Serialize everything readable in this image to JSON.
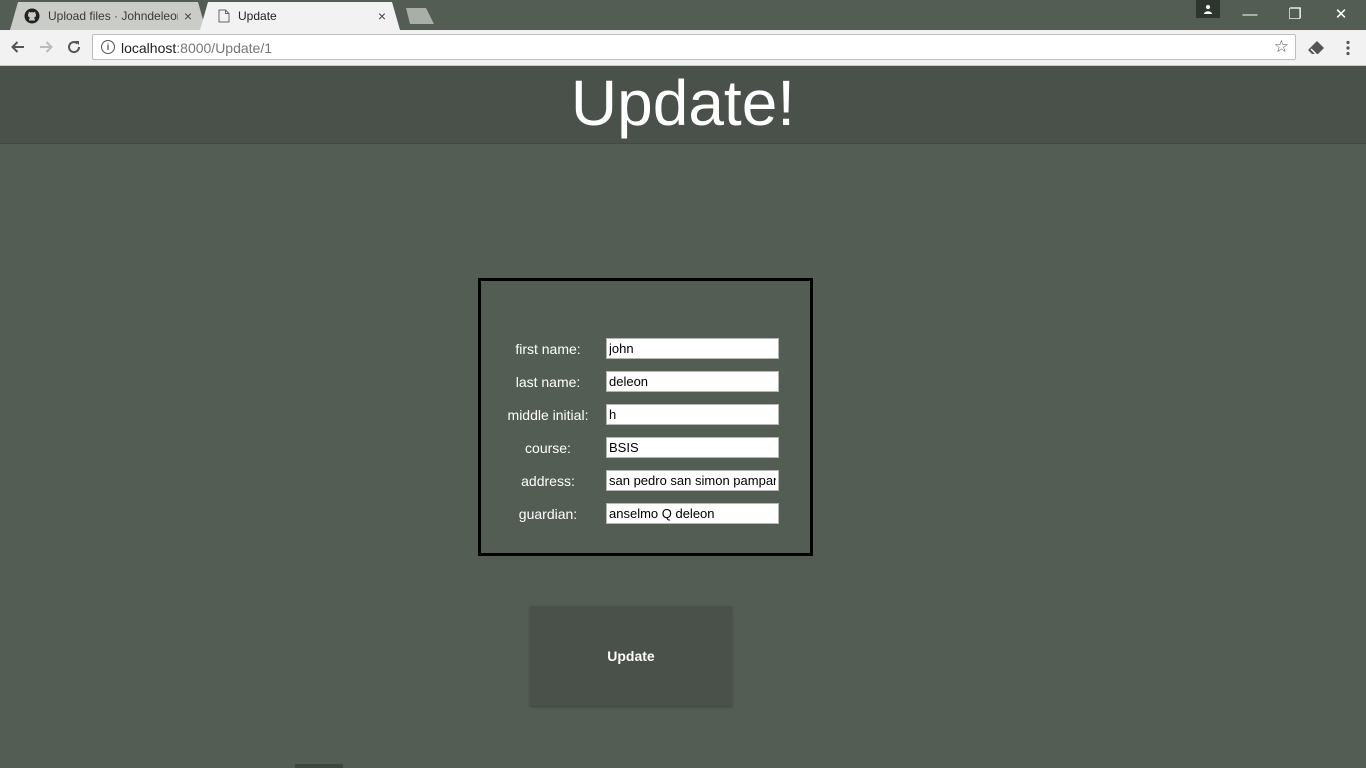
{
  "browser": {
    "tabs": [
      {
        "label": "Upload files · Johndeleon",
        "close": "×",
        "icon": "github-icon"
      },
      {
        "label": "Update",
        "close": "×",
        "icon": "page-icon"
      }
    ],
    "url_host": "localhost",
    "url_rest": ":8000/Update/1",
    "window_controls": {
      "minimize": "—",
      "restore": "❐",
      "close": "✕"
    }
  },
  "page": {
    "title": "Update!",
    "fields": [
      {
        "label": "first name:",
        "value": "john"
      },
      {
        "label": "last name:",
        "value": "deleon"
      },
      {
        "label": "middle initial:",
        "value": "h"
      },
      {
        "label": "course:",
        "value": "BSIS"
      },
      {
        "label": "address:",
        "value": "san pedro san simon pampanga"
      },
      {
        "label": "guardian:",
        "value": "anselmo Q deleon"
      }
    ],
    "submit_label": "Update"
  },
  "colors": {
    "page_background": "#535d53",
    "header_background": "#4a514a",
    "button_background": "#4a514a",
    "text": "#ffffff"
  }
}
